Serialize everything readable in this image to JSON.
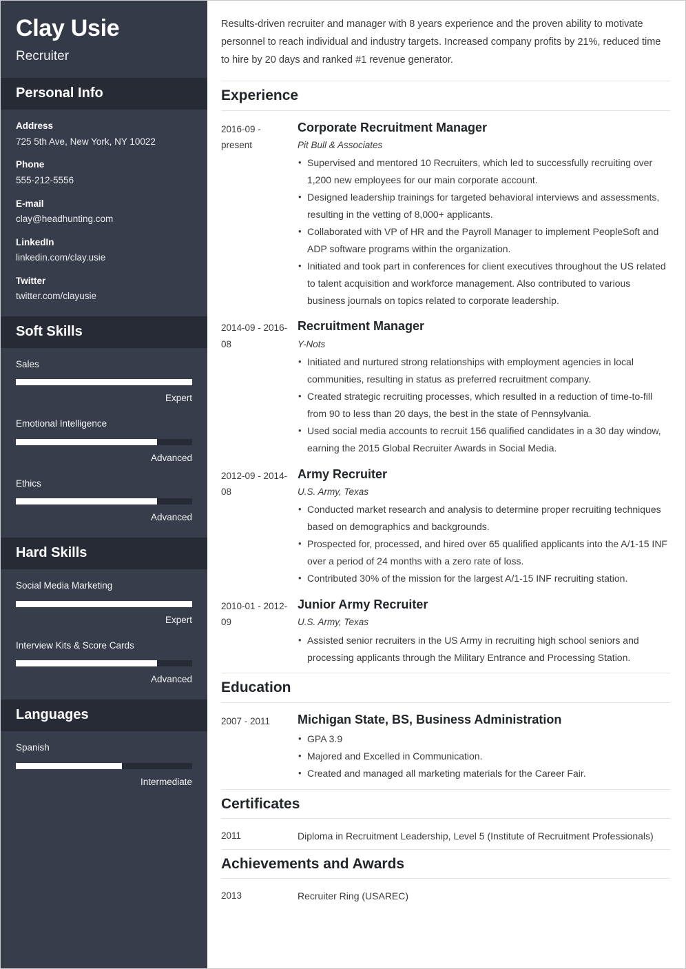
{
  "sidebar": {
    "name": "Clay Usie",
    "role": "Recruiter",
    "personal_info": {
      "heading": "Personal Info",
      "items": [
        {
          "label": "Address",
          "value": "725 5th Ave, New York, NY 10022"
        },
        {
          "label": "Phone",
          "value": "555-212-5556"
        },
        {
          "label": "E-mail",
          "value": "clay@headhunting.com"
        },
        {
          "label": "LinkedIn",
          "value": "linkedin.com/clay.usie"
        },
        {
          "label": "Twitter",
          "value": "twitter.com/clayusie"
        }
      ]
    },
    "soft_skills": {
      "heading": "Soft Skills",
      "items": [
        {
          "name": "Sales",
          "level": "Expert",
          "percent": 100
        },
        {
          "name": "Emotional Intelligence",
          "level": "Advanced",
          "percent": 80
        },
        {
          "name": "Ethics",
          "level": "Advanced",
          "percent": 80
        }
      ]
    },
    "hard_skills": {
      "heading": "Hard Skills",
      "items": [
        {
          "name": "Social Media Marketing",
          "level": "Expert",
          "percent": 100
        },
        {
          "name": "Interview Kits & Score Cards",
          "level": "Advanced",
          "percent": 80
        }
      ]
    },
    "languages": {
      "heading": "Languages",
      "items": [
        {
          "name": "Spanish",
          "level": "Intermediate",
          "percent": 60
        }
      ]
    }
  },
  "main": {
    "summary": "Results-driven recruiter and manager with 8 years experience and the proven ability to motivate personnel to reach individual and industry targets. Increased company profits by 21%, reduced time to hire by 20 days and ranked #1 revenue generator.",
    "experience": {
      "heading": "Experience",
      "entries": [
        {
          "date": "2016-09 - present",
          "title": "Corporate Recruitment Manager",
          "subtitle": "Pit Bull & Associates",
          "bullets": [
            "Supervised and mentored 10 Recruiters, which led to successfully recruiting over 1,200 new employees for our main corporate account.",
            "Designed leadership trainings for targeted behavioral interviews and assessments, resulting in the vetting of 8,000+ applicants.",
            "Collaborated with VP of HR and the Payroll Manager to implement PeopleSoft and ADP software programs within the organization.",
            "Initiated and took part in conferences for client executives throughout the US related to talent acquisition and workforce management. Also contributed to various business journals on topics related to corporate leadership."
          ]
        },
        {
          "date": "2014-09 - 2016-08",
          "title": "Recruitment Manager",
          "subtitle": "Y-Nots",
          "bullets": [
            "Initiated and nurtured strong relationships with employment agencies in local communities, resulting in status as preferred recruitment company.",
            "Created strategic recruiting processes, which resulted in a reduction of time-to-fill from 90 to less than 20 days, the best in the state of Pennsylvania.",
            "Used social media accounts to recruit 156 qualified candidates in a 30 day window, earning the 2015 Global Recruiter Awards in Social Media."
          ]
        },
        {
          "date": "2012-09 - 2014-08",
          "title": "Army Recruiter",
          "subtitle": "U.S. Army, Texas",
          "bullets": [
            "Conducted market research and analysis to determine proper recruiting techniques based on demographics and backgrounds.",
            "Prospected for, processed, and hired over 65 qualified applicants into the A/1-15 INF over a period of 24 months with a zero rate of loss.",
            "Contributed 30% of the mission for the largest A/1-15 INF recruiting station."
          ]
        },
        {
          "date": "2010-01 - 2012-09",
          "title": "Junior Army Recruiter",
          "subtitle": "U.S. Army, Texas",
          "bullets": [
            "Assisted senior recruiters in the US Army in recruiting high school seniors and processing applicants through the Military Entrance and Processing Station."
          ]
        }
      ]
    },
    "education": {
      "heading": "Education",
      "entries": [
        {
          "date": "2007 - 2011",
          "title": "Michigan State, BS, Business Administration",
          "bullets": [
            "GPA 3.9",
            "Majored and Excelled in Communication.",
            "Created and managed all marketing materials for the Career Fair."
          ]
        }
      ]
    },
    "certificates": {
      "heading": "Certificates",
      "entries": [
        {
          "date": "2011",
          "text": "Diploma in Recruitment Leadership, Level 5  (Institute of Recruitment Professionals)"
        }
      ]
    },
    "achievements": {
      "heading": "Achievements and Awards",
      "entries": [
        {
          "date": "2013",
          "text": "Recruiter Ring (USAREC)"
        }
      ]
    }
  }
}
